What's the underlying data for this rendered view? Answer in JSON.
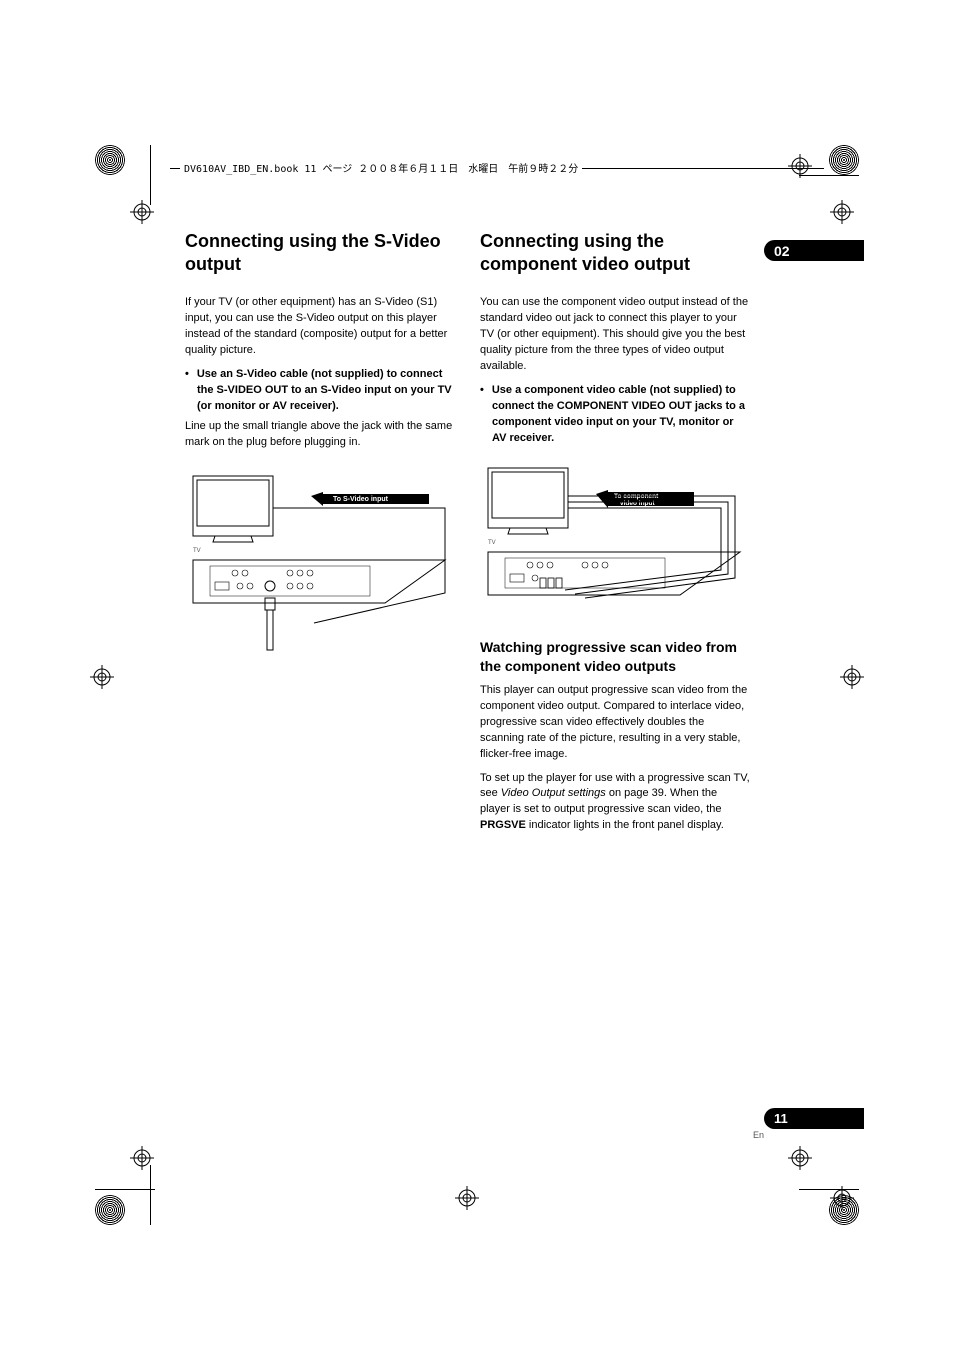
{
  "header_text": "DV610AV_IBD_EN.book  11 ページ  ２００８年６月１１日　水曜日　午前９時２２分",
  "chapter_number": "02",
  "page_number": "11",
  "lang": "En",
  "col1": {
    "h1": "Connecting using the S-Video output",
    "p1": "If your TV (or other equipment) has an S-Video (S1) input, you can use the S-Video output on this player instead of the standard (composite) output for a better quality picture.",
    "bullet": "Use an S-Video cable (not supplied) to connect the S-VIDEO OUT to an S-Video input on your TV (or monitor or AV receiver).",
    "p2": "Line up the small triangle above the jack with the same mark on the plug before plugging in.",
    "diagram_label_arrow": "To S-Video input",
    "diagram_tv": "TV"
  },
  "col2": {
    "h1": "Connecting using the component video output",
    "p1": "You can use the component video output instead of the standard video out jack to connect this player to your TV (or other equipment). This should give you the best quality picture from the three types of video output available.",
    "bullet": "Use a component video cable (not supplied) to connect the COMPONENT VIDEO OUT jacks to a component video input on your TV, monitor or AV receiver.",
    "diagram_label_arrow": "To component video input",
    "diagram_tv": "TV",
    "h2": "Watching progressive scan video from the component video outputs",
    "p2": "This player can output progressive scan video from the component video output. Compared to interlace video, progressive scan video effectively doubles the scanning rate of the picture, resulting in a very stable, flicker-free image.",
    "p3_a": "To set up the player for use with a progressive scan TV, see ",
    "p3_italic": "Video Output settings",
    "p3_b": " on page 39. When the player is set to output progressive scan video, the ",
    "p3_bold": "PRGSVE",
    "p3_c": " indicator lights in the front panel display."
  }
}
